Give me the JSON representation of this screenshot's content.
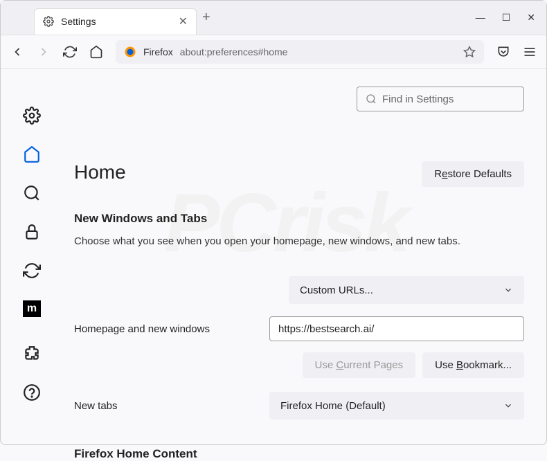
{
  "tab": {
    "title": "Settings"
  },
  "urlbar": {
    "identity": "Firefox",
    "url": "about:preferences#home"
  },
  "search": {
    "placeholder": "Find in Settings"
  },
  "page": {
    "title": "Home"
  },
  "buttons": {
    "restore_pre": "R",
    "restore_mid": "e",
    "restore_post": "store Defaults",
    "use_current_pre": "Use ",
    "use_current_mid": "C",
    "use_current_post": "urrent Pages",
    "use_bookmark_pre": "Use ",
    "use_bookmark_mid": "B",
    "use_bookmark_post": "ookmark..."
  },
  "sections": {
    "nwt_title": "New Windows and Tabs",
    "nwt_desc": "Choose what you see when you open your homepage, new windows, and new tabs.",
    "home_content": "Firefox Home Content"
  },
  "fields": {
    "homepage_label": "Homepage and new windows",
    "homepage_dropdown": "Custom URLs...",
    "homepage_url": "https://bestsearch.ai/",
    "newtabs_label": "New tabs",
    "newtabs_dropdown": "Firefox Home (Default)"
  }
}
